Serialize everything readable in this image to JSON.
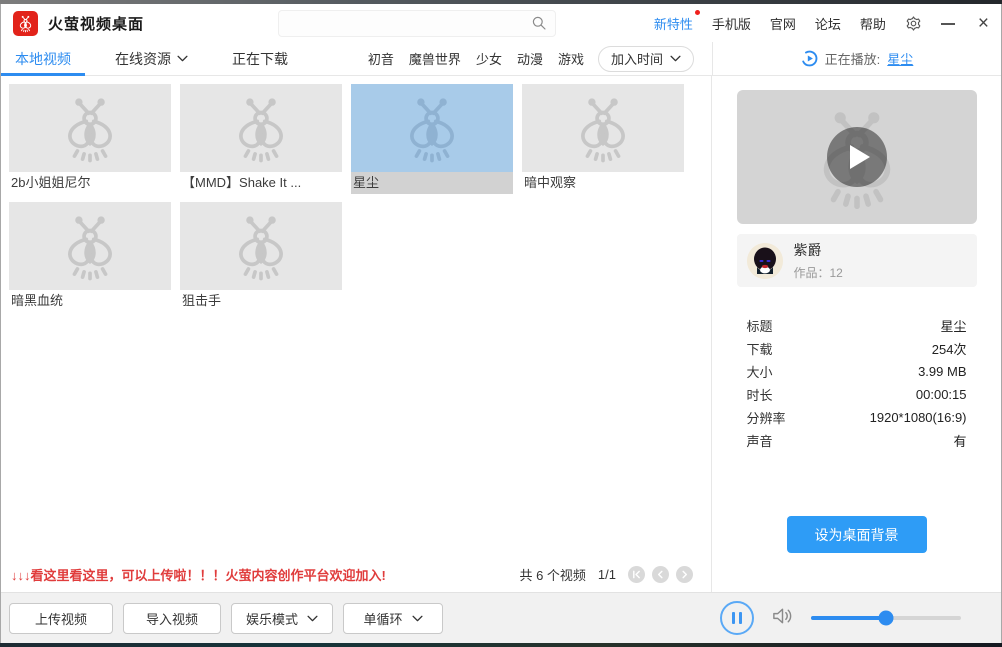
{
  "window": {
    "title": "火萤视频桌面",
    "controls": {
      "minimize": "minimize",
      "close": "×"
    }
  },
  "header": {
    "search": {
      "value": "",
      "placeholder": ""
    },
    "links": [
      {
        "label": "新特性",
        "badge": true
      },
      {
        "label": "手机版"
      },
      {
        "label": "官网"
      },
      {
        "label": "论坛"
      },
      {
        "label": "帮助"
      }
    ]
  },
  "tabs": [
    {
      "label": "本地视频",
      "active": true
    },
    {
      "label": "在线资源",
      "dropdown": true
    },
    {
      "label": "正在下载"
    }
  ],
  "categories": [
    "初音",
    "魔兽世界",
    "少女",
    "动漫",
    "游戏"
  ],
  "sort_dropdown": {
    "selected": "加入时间"
  },
  "now_playing": {
    "prefix": "正在播放:",
    "title": "星尘"
  },
  "videos": [
    {
      "title": "2b小姐姐尼尔",
      "selected": false
    },
    {
      "title": "【MMD】Shake It ...",
      "selected": false
    },
    {
      "title": "星尘",
      "selected": true
    },
    {
      "title": "暗中观察",
      "selected": false
    },
    {
      "title": "暗黑血统",
      "selected": false
    },
    {
      "title": "狙击手",
      "selected": false
    }
  ],
  "announcement": "↓↓↓看这里看这里，可以上传啦！！！火萤内容创作平台欢迎加入!",
  "pagination": {
    "count_text": "共 6 个视频",
    "page": "1/1"
  },
  "player_panel": {
    "author": {
      "name": "紫爵",
      "works": "作品：12"
    },
    "details": [
      {
        "label": "标题",
        "value": "星尘"
      },
      {
        "label": "下载",
        "value": "254次"
      },
      {
        "label": "大小",
        "value": "3.99 MB"
      },
      {
        "label": "时长",
        "value": "00:00:15"
      },
      {
        "label": "分辨率",
        "value": "1920*1080(16:9)"
      },
      {
        "label": "声音",
        "value": "有"
      }
    ],
    "set_wallpaper_button": "设为桌面背景"
  },
  "toolbar": {
    "upload_button": "上传视频",
    "import_button": "导入视频",
    "mode_dropdown": "娱乐模式",
    "loop_dropdown": "单循环",
    "volume_percent": 50
  },
  "colors": {
    "accent": "#2d8cf0",
    "brand_red": "#e2231a",
    "announcement_red": "#e03c3c",
    "selected_thumb": "#a8cbe9",
    "wallpaper_button": "#2e9cf6"
  }
}
